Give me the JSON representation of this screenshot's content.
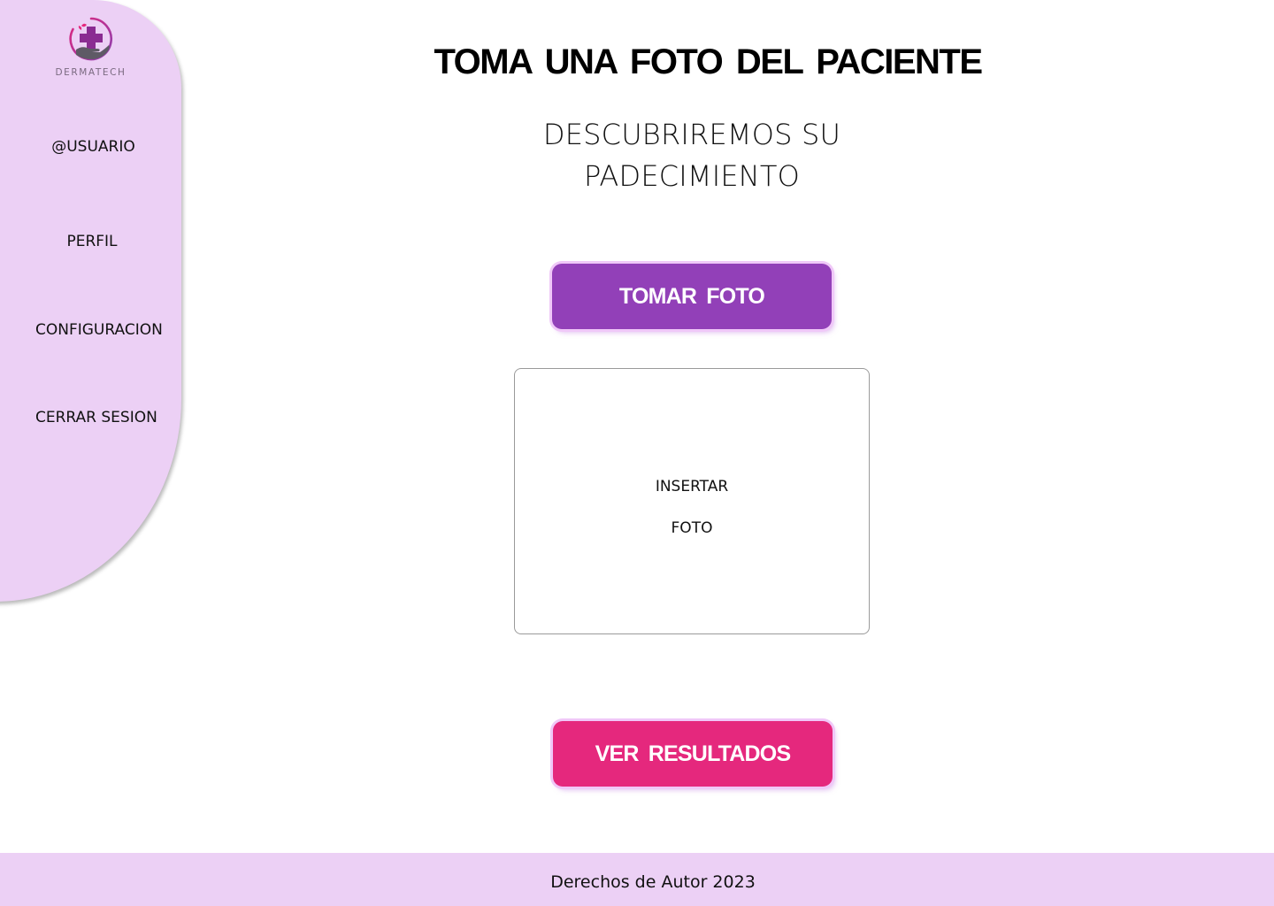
{
  "sidebar": {
    "brand": "DERMATECH",
    "items": [
      {
        "label": "@USUARIO"
      },
      {
        "label": "PERFIL"
      },
      {
        "label": "CONFIGURACION"
      },
      {
        "label": "CERRAR SESION"
      }
    ]
  },
  "main": {
    "title": "TOMA UNA  FOTO  DEL  PACIENTE",
    "subtitle_line1": "DESCUBRIREMOS SU",
    "subtitle_line2": "PADECIMIENTO",
    "take_photo_label": "TOMAR  FOTO",
    "photo_placeholder_line1": "INSERTAR",
    "photo_placeholder_line2": "FOTO",
    "results_label": "VER  RESULTADOS"
  },
  "footer": {
    "text": "Derechos de Autor 2023"
  },
  "colors": {
    "sidebar_bg": "#ecd0f5",
    "footer_bg": "#ecd0f5",
    "take_photo_button": "#9240b8",
    "results_button": "#e5287d",
    "logo_accent": "#b02fa0"
  },
  "icons": {
    "logo": "medical-cross-hand-icon"
  }
}
